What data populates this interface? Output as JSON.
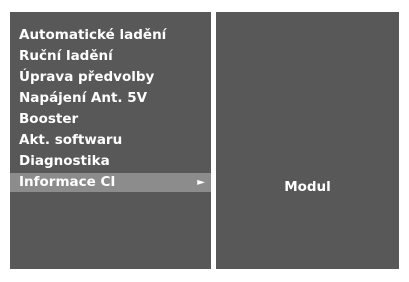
{
  "menu": {
    "items": [
      {
        "label": "Automatické ladění"
      },
      {
        "label": "Ruční ladění"
      },
      {
        "label": "Úprava předvolby"
      },
      {
        "label": "Napájení Ant. 5V"
      },
      {
        "label": "Booster"
      },
      {
        "label": "Akt. softwaru"
      },
      {
        "label": "Diagnostika"
      },
      {
        "label": "Informace CI",
        "selected": true
      }
    ],
    "selected_arrow": "►"
  },
  "submenu": {
    "label": "Modul"
  },
  "colors": {
    "panel_background": "#585858",
    "selected_highlight": "#8c8c8c",
    "text": "#ffffff"
  }
}
